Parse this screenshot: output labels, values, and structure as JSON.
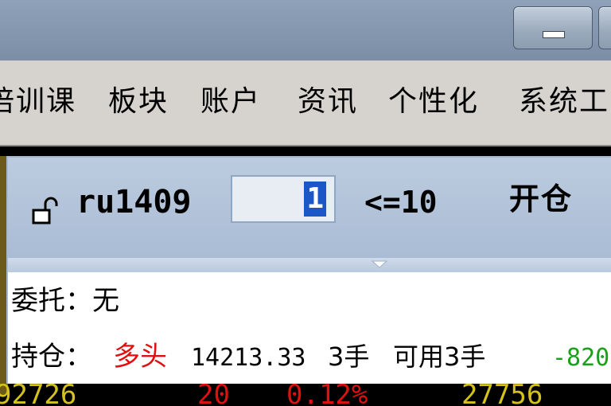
{
  "window": {
    "colors": {
      "titlebar": "#8fa1b8",
      "menubar": "#d6d3ce",
      "panel_header": "#bccbdf"
    }
  },
  "menu": {
    "items": [
      "培训课",
      "板块",
      "账户",
      "资讯",
      "个性化",
      "系统工"
    ]
  },
  "order_panel": {
    "symbol": "ru1409",
    "quantity": "1",
    "quantity_limit": "<=10",
    "open_button_label": "开仓",
    "entrust": {
      "label": "委托：",
      "value": "无"
    },
    "position": {
      "label": "持仓：",
      "direction": "多头",
      "direction_color": "#e01010",
      "avg_price": "14213.33",
      "lots": "3手",
      "available": "可用3手",
      "pnl": "-820",
      "pnl_color": "#1aa01a"
    }
  },
  "quote_row": {
    "cells": [
      {
        "text": "92726",
        "color": "#d4c21a"
      },
      {
        "text": "20",
        "color": "#e01010"
      },
      {
        "text": "0.12%",
        "color": "#e01010"
      },
      {
        "text": "27756",
        "color": "#d4c21a"
      }
    ]
  }
}
